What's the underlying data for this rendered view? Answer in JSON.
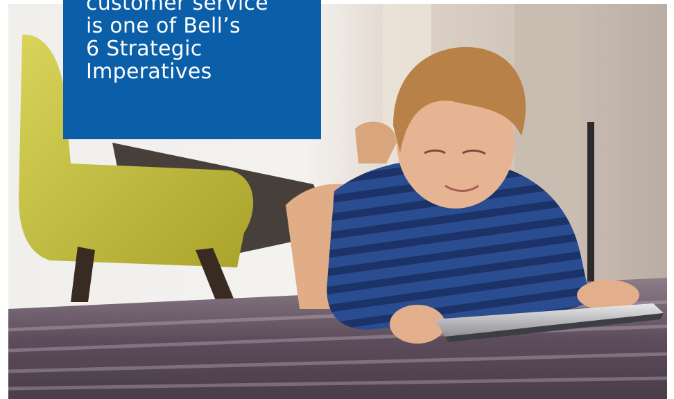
{
  "callout": {
    "lines": [
      "customer service",
      "is one of Bell’s",
      "6 Strategic",
      "Imperatives"
    ]
  },
  "photo": {
    "subject": "child-with-tablet"
  },
  "colors": {
    "callout_bg": "#0b5ea8",
    "callout_text": "#ffffff",
    "chair": "#c9c33c",
    "shirt_dark": "#1f3d7a",
    "shirt_light": "#3d66b0",
    "carpet": "#5c4b5a"
  }
}
